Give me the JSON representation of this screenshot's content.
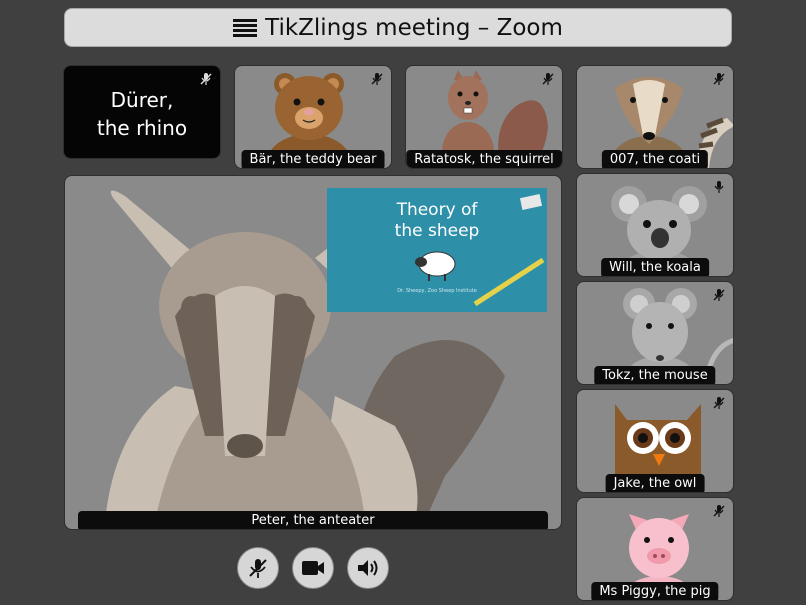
{
  "window": {
    "title": "TikZlings meeting – Zoom"
  },
  "participants": [
    {
      "id": "rhino",
      "name_line1": "Dürer,",
      "name_line2": "the rhino",
      "muted": true
    },
    {
      "id": "teddy",
      "name": "Bär, the teddy bear",
      "muted": true
    },
    {
      "id": "squirrel",
      "name": "Ratatosk, the squirrel",
      "muted": true
    },
    {
      "id": "coati",
      "name": "007, the coati",
      "muted": true
    },
    {
      "id": "koala",
      "name": "Will, the koala",
      "muted": false
    },
    {
      "id": "mouse",
      "name": "Tokz, the mouse",
      "muted": true
    },
    {
      "id": "owl",
      "name": "Jake, the owl",
      "muted": true
    },
    {
      "id": "pig",
      "name": "Ms Piggy, the pig",
      "muted": true
    }
  ],
  "main_speaker": {
    "name": "Peter, the anteater"
  },
  "shared_slide": {
    "title_line1": "Theory of",
    "title_line2": "the sheep",
    "subtitle": "Dr. Sheepy, Zoo Sheep Institute"
  },
  "controls": {
    "mic": {
      "icon": "mic-muted-icon"
    },
    "camera": {
      "icon": "video-camera-icon"
    },
    "speaker": {
      "icon": "speaker-icon"
    }
  },
  "colors": {
    "background": "#404040",
    "tile": "#8a8a8a",
    "label_bg": "#0c0c0c",
    "slide": "#2d8fa8"
  }
}
